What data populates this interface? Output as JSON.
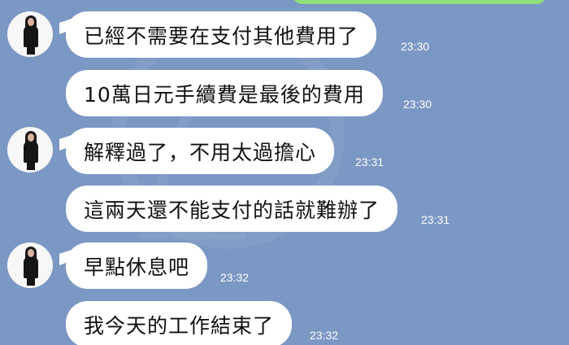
{
  "messages": [
    {
      "text": "已經不需要在支付其他費用了",
      "time": "23:30"
    },
    {
      "text": "10萬日元手續費是最後的費用",
      "time": "23:30"
    },
    {
      "text": "解釋過了，不用太過擔心",
      "time": "23:31"
    },
    {
      "text": "這兩天還不能支付的話就難辦了",
      "time": "23:31"
    },
    {
      "text": "早點休息吧",
      "time": "23:32"
    },
    {
      "text": "我今天的工作結束了",
      "time": "23:32"
    }
  ],
  "colors": {
    "background": "#7b97c3",
    "bubble_incoming": "#ffffff",
    "bubble_outgoing": "#8fe07a",
    "timestamp": "#ffffff"
  },
  "icons": {
    "avatar": "profile-avatar-icon"
  }
}
